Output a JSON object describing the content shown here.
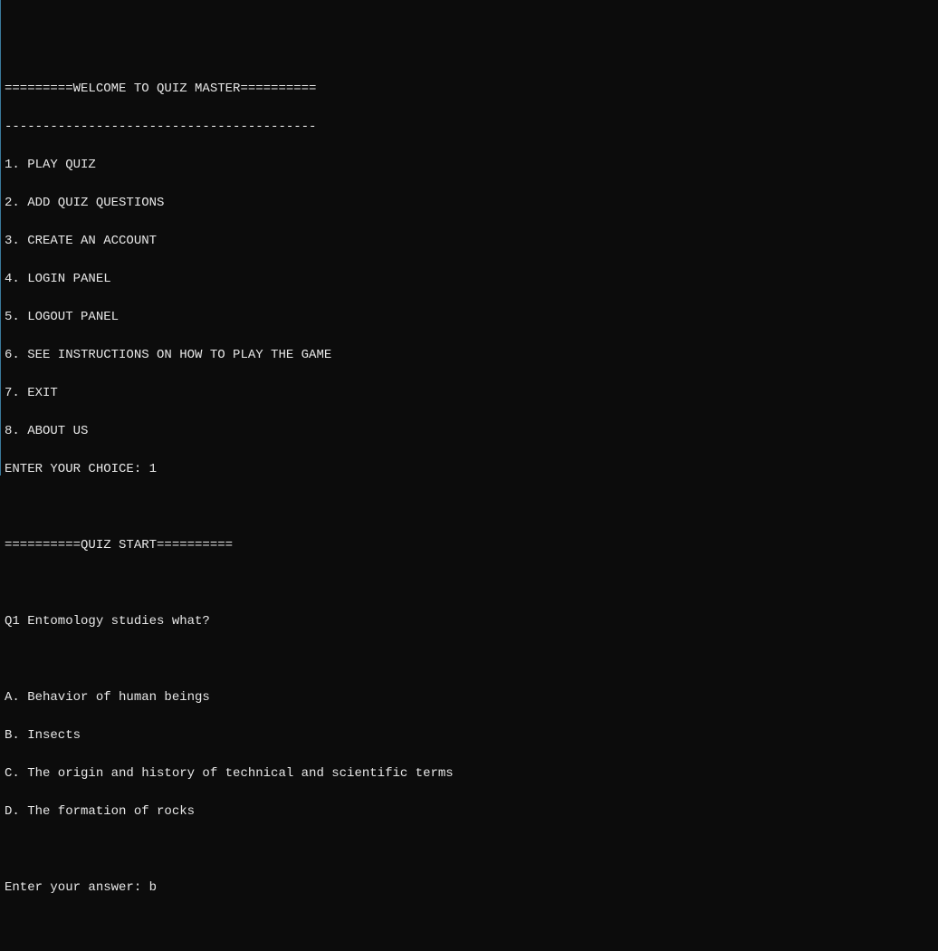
{
  "header": {
    "title": "=========WELCOME TO QUIZ MASTER==========",
    "separator": "-----------------------------------------"
  },
  "menu": {
    "items": [
      "1. PLAY QUIZ",
      "2. ADD QUIZ QUESTIONS",
      "3. CREATE AN ACCOUNT",
      "4. LOGIN PANEL",
      "5. LOGOUT PANEL",
      "6. SEE INSTRUCTIONS ON HOW TO PLAY THE GAME",
      "7. EXIT",
      "8. ABOUT US"
    ],
    "prompt": "ENTER YOUR CHOICE: ",
    "choice": "1"
  },
  "quiz": {
    "banner": "==========QUIZ START==========",
    "question_label": "Q1 Entomology studies what?",
    "options": [
      "A. Behavior of human beings",
      "B. Insects",
      "C. The origin and history of technical and scientific terms",
      "D. The formation of rocks"
    ],
    "answer_prompt": "Enter your answer: ",
    "answer_value": "b"
  }
}
